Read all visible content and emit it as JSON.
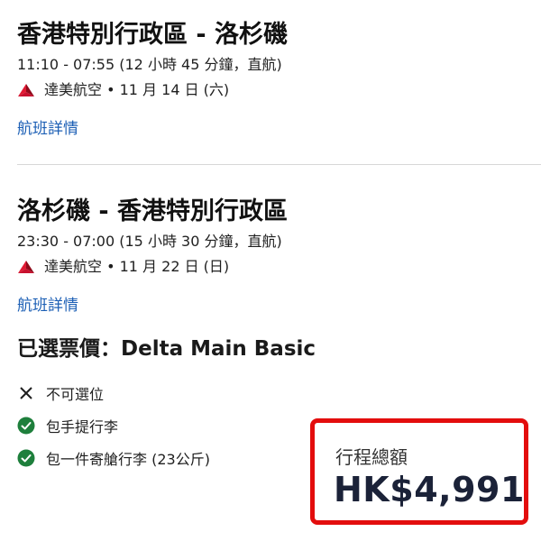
{
  "outbound": {
    "route": "香港特別行政區 - 洛杉磯",
    "times": "11:10 - 07:55 (12 小時 45 分鐘，直航)",
    "airline_date": "達美航空 • 11 月 14 日 (六)",
    "details_link": "航班詳情"
  },
  "return": {
    "route": "洛杉磯 - 香港特別行政區",
    "times": "23:30 - 07:00 (15 小時 30 分鐘，直航)",
    "airline_date": "達美航空 • 11 月 22 日 (日)",
    "details_link": "航班詳情"
  },
  "fare": {
    "title": "已選票價：Delta Main Basic",
    "features": [
      {
        "icon": "x-icon",
        "text": "不可選位"
      },
      {
        "icon": "check-circle-icon",
        "text": "包手提行李"
      },
      {
        "icon": "check-circle-icon",
        "text": "包一件寄艙行李 (23公斤)"
      }
    ]
  },
  "total": {
    "label": "行程總額",
    "amount": "HK$4,991"
  },
  "colors": {
    "link": "#1c5fb5",
    "delta_red": "#e01933",
    "check_green": "#1e7f3c",
    "highlight_border": "#e30d0d",
    "price_text": "#1b2238"
  }
}
